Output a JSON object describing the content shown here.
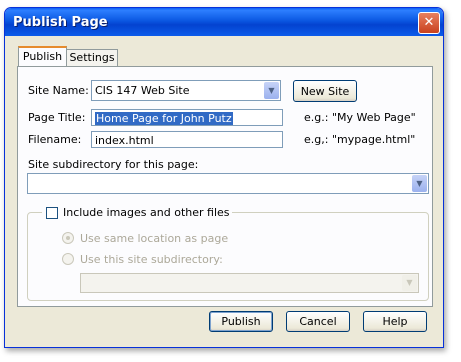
{
  "window": {
    "title": "Publish Page",
    "close_glyph": "✕"
  },
  "tabs": [
    {
      "label": "Publish",
      "active": true
    },
    {
      "label": "Settings",
      "active": false
    }
  ],
  "form": {
    "site_name_label": "Site Name:",
    "site_name_value": "CIS 147 Web Site",
    "new_site_button": "New Site",
    "page_title_label": "Page Title:",
    "page_title_value": "Home Page for John Putz",
    "page_title_hint": "e.g.: \"My Web Page\"",
    "filename_label": "Filename:",
    "filename_value": "index.html",
    "filename_hint": "e.g,: \"mypage.html\"",
    "subdirectory_label": "Site subdirectory for this page:",
    "subdirectory_value": ""
  },
  "images_group": {
    "include_label": "Include images and other files",
    "include_checked": false,
    "option_same_location": "Use same location as page",
    "option_site_subdirectory": "Use this site subdirectory:",
    "subdirectory_value": ""
  },
  "buttons": {
    "publish": "Publish",
    "cancel": "Cancel",
    "help": "Help"
  },
  "icons": {
    "dropdown": "chevron-down-icon",
    "close": "close-icon"
  }
}
